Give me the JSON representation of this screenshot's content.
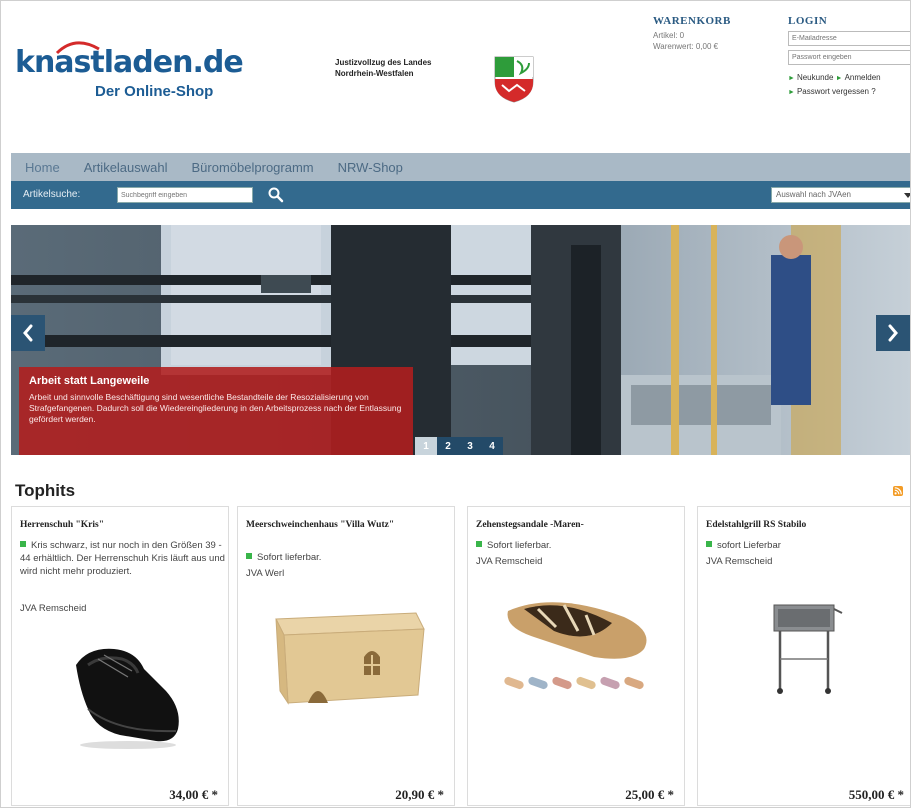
{
  "header": {
    "logo_main": "knastladen.de",
    "logo_sub": "Der Online-Shop",
    "justice_line1": "Justizvollzug des Landes",
    "justice_line2": "Nordrhein-Westfalen"
  },
  "cart": {
    "title": "WARENKORB",
    "items_line": "Artikel: 0",
    "value_line": "Warenwert: 0,00 €"
  },
  "login": {
    "title": "LOGIN",
    "email_placeholder": "E-Mailadresse",
    "password_placeholder": "Passwort eingeben",
    "link_newcustomer": "Neukunde",
    "link_login": "Anmelden",
    "link_forgot": "Passwort vergessen ?"
  },
  "nav": {
    "items": [
      "Home",
      "Artikelauswahl",
      "Büromöbelprogramm",
      "NRW-Shop"
    ]
  },
  "search": {
    "label": "Artikelsuche:",
    "placeholder": "Suchbegriff eingeben",
    "region_select": "Auswahl nach JVAen"
  },
  "slider": {
    "caption_title": "Arbeit statt Langeweile",
    "caption_text": "Arbeit und sinnvolle Beschäftigung sind wesentliche Bestandteile der Resozialisierung von Strafgefangenen. Dadurch soll die Wiedereingliederung in den Arbeitsprozess nach der Entlassung gefördert werden.",
    "pages": [
      "1",
      "2",
      "3",
      "4"
    ],
    "active_page": 1,
    "prev_glyph": "‹",
    "next_glyph": "›"
  },
  "tophits": {
    "title": "Tophits",
    "products": [
      {
        "name": "Herrenschuh \"Kris\"",
        "info": "Kris schwarz, ist nur noch in den Größen 39 - 44 erhältlich. Der Herrenschuh Kris läuft aus und wird nicht mehr produziert.",
        "shop": "JVA Remscheid",
        "price": "34,00 € *"
      },
      {
        "name": "Meerschweinchenhaus \"Villa Wutz\"",
        "info": "Sofort lieferbar.",
        "shop": "JVA Werl",
        "price": "20,90 € *"
      },
      {
        "name": "Zehenstegsandale -Maren-",
        "info": "Sofort lieferbar.",
        "shop": "JVA Remscheid",
        "price": "25,00 € *"
      },
      {
        "name": "Edelstahlgrill RS Stabilo",
        "info": "sofort Lieferbar",
        "shop": "JVA Remscheid",
        "price": "550,00 € *"
      }
    ]
  },
  "colors": {
    "brand_blue": "#1c5c94",
    "brand_red": "#d42a2a",
    "nav_bg": "#a9b9c6",
    "searchbar_bg": "#336a8e",
    "caption_red": "#b21e1e",
    "stock_green": "#39b54a"
  }
}
